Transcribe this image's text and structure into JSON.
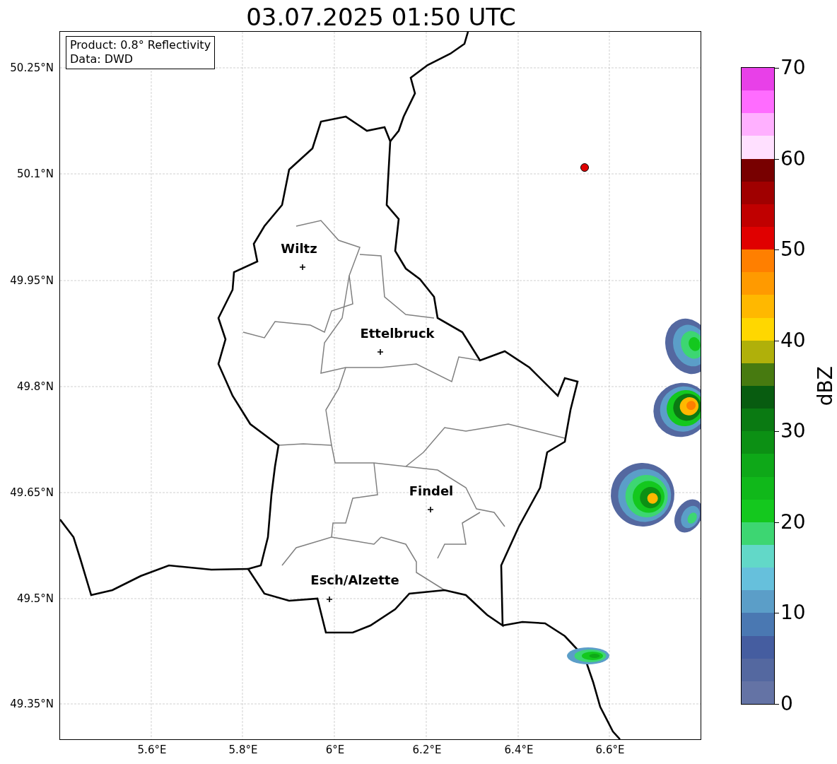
{
  "title": "03.07.2025 01:50 UTC",
  "info_box": {
    "lines": [
      "Product: 0.8° Reflectivity",
      "Data: DWD"
    ]
  },
  "y_ticks": [
    "50.25°N",
    "50.1°N",
    "49.95°N",
    "49.8°N",
    "49.65°N",
    "49.5°N",
    "49.35°N"
  ],
  "x_ticks": [
    "5.6°E",
    "5.8°E",
    "6°E",
    "6.2°E",
    "6.4°E",
    "6.6°E"
  ],
  "cities": [
    {
      "name": "Wiltz"
    },
    {
      "name": "Ettelbruck"
    },
    {
      "name": "Findel"
    },
    {
      "name": "Esch/Alzette"
    }
  ],
  "colorbar": {
    "label": "dBZ",
    "ticks": [
      "70",
      "60",
      "50",
      "40",
      "30",
      "20",
      "10",
      "0"
    ],
    "bins": [
      {
        "color": "#6473a5"
      },
      {
        "color": "#5468a0"
      },
      {
        "color": "#455da0"
      },
      {
        "color": "#4a78b2"
      },
      {
        "color": "#5b9ec8"
      },
      {
        "color": "#66c0dc"
      },
      {
        "color": "#62d8c8"
      },
      {
        "color": "#3dd672"
      },
      {
        "color": "#14c81e"
      },
      {
        "color": "#10b81a"
      },
      {
        "color": "#0ea818"
      },
      {
        "color": "#0c9014"
      },
      {
        "color": "#0a7a12"
      },
      {
        "color": "#085c10"
      },
      {
        "color": "#477a10"
      },
      {
        "color": "#b0b00a"
      },
      {
        "color": "#ffd700"
      },
      {
        "color": "#ffb800"
      },
      {
        "color": "#ff9a00"
      },
      {
        "color": "#ff7f00"
      },
      {
        "color": "#e00000"
      },
      {
        "color": "#c00000"
      },
      {
        "color": "#a00000"
      },
      {
        "color": "#780000"
      },
      {
        "color": "#ffe0ff"
      },
      {
        "color": "#ffb0ff"
      },
      {
        "color": "#ff6cff"
      },
      {
        "color": "#e840e8"
      }
    ]
  }
}
